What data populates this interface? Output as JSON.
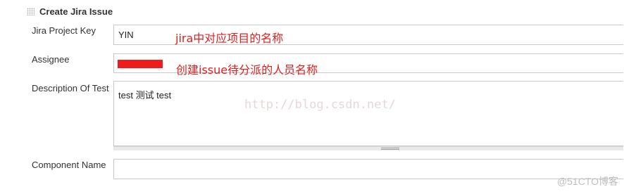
{
  "section": {
    "title": "Create Jira Issue",
    "handle_icon": "drag-handle-icon"
  },
  "fields": {
    "project_key": {
      "label": "Jira Project Key",
      "value": "YIN",
      "note": "jira中对应项目的名称"
    },
    "assignee": {
      "label": "Assignee",
      "value": "",
      "note": "创建issue待分派的人员名称"
    },
    "description": {
      "label": "Description Of Test",
      "value": "test 测试 test"
    },
    "component": {
      "label": "Component Name",
      "value": ""
    }
  },
  "overlay": {
    "watermark": "http://blog.csdn.net/",
    "corner_mark": "@51CTO博客"
  },
  "colors": {
    "annotation": "#e02020",
    "redaction": "#ee1c1c",
    "border": "#c9c9c9"
  }
}
